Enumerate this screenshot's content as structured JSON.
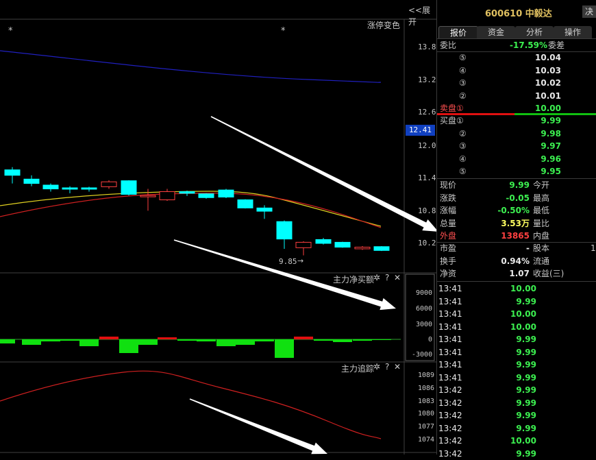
{
  "toolbar": {
    "expand_label": "<<展开"
  },
  "main_chart": {
    "marker_left": "*",
    "marker_mid": "*",
    "limit_color_label": "涨停变色",
    "price_ticks": [
      "13.8",
      "13.2",
      "12.6",
      "12.41",
      "12.0",
      "11.4",
      "10.8",
      "10.2"
    ],
    "low_label": "9.85"
  },
  "flow_panel": {
    "title": "主力净买额",
    "ticks": [
      "9000",
      "6000",
      "3000",
      "0",
      "-3000"
    ]
  },
  "track_panel": {
    "title": "主力追踪",
    "ticks": [
      "1089",
      "1086",
      "1083",
      "1080",
      "1077",
      "1074"
    ]
  },
  "quote": {
    "header": "600610 中毅达",
    "decide_button": "决",
    "tabs": [
      "报价",
      "资金",
      "分析",
      "操作"
    ],
    "weibi_label": "委比",
    "weibi_value": "-17.59%",
    "weicha_label": "委差",
    "sell": [
      {
        "label": "⑤",
        "price": "10.04"
      },
      {
        "label": "④",
        "price": "10.03"
      },
      {
        "label": "③",
        "price": "10.02"
      },
      {
        "label": "②",
        "price": "10.01"
      },
      {
        "label": "卖盘①",
        "price": "10.00"
      }
    ],
    "buy": [
      {
        "label": "买盘①",
        "price": "9.99"
      },
      {
        "label": "②",
        "price": "9.98"
      },
      {
        "label": "③",
        "price": "9.97"
      },
      {
        "label": "④",
        "price": "9.96"
      },
      {
        "label": "⑤",
        "price": "9.95"
      }
    ],
    "stats": [
      {
        "label": "现价",
        "value": "9.99",
        "extra": "今开",
        "color": "green"
      },
      {
        "label": "涨跌",
        "value": "-0.05",
        "extra": "最高",
        "color": "green"
      },
      {
        "label": "涨幅",
        "value": "-0.50%",
        "extra": "最低",
        "color": "green"
      },
      {
        "label": "总量",
        "value": "3.53万",
        "extra": "量比",
        "color": "yellow"
      },
      {
        "label": "外盘",
        "value": "13865",
        "extra": "内盘",
        "color": "red"
      }
    ],
    "stats2": [
      {
        "label": "市盈",
        "value": "-",
        "extra": "股本",
        "tail": "1"
      },
      {
        "label": "换手",
        "value": "0.94%",
        "extra": "流通",
        "tail": ""
      },
      {
        "label": "净资",
        "value": "1.07",
        "extra": "收益(三)",
        "tail": ""
      }
    ],
    "ticks": [
      {
        "time": "13:41",
        "price": "10.00"
      },
      {
        "time": "13:41",
        "price": "9.99"
      },
      {
        "time": "13:41",
        "price": "10.00"
      },
      {
        "time": "13:41",
        "price": "10.00"
      },
      {
        "time": "13:41",
        "price": "9.99"
      },
      {
        "time": "13:41",
        "price": "9.99"
      },
      {
        "time": "13:41",
        "price": "9.99"
      },
      {
        "time": "13:41",
        "price": "9.99"
      },
      {
        "time": "13:42",
        "price": "9.99"
      },
      {
        "time": "13:42",
        "price": "9.99"
      },
      {
        "time": "13:42",
        "price": "9.99"
      },
      {
        "time": "13:42",
        "price": "9.99"
      },
      {
        "time": "13:42",
        "price": "10.00"
      },
      {
        "time": "13:42",
        "price": "9.99"
      }
    ]
  },
  "colors": {
    "up": "#ff4040",
    "down": "#00ffff",
    "ma_yellow": "#e0d020",
    "ma_red": "#d02020",
    "ma_blue": "#2020c0",
    "flow_pos": "#e01010",
    "flow_neg": "#10e010"
  }
}
